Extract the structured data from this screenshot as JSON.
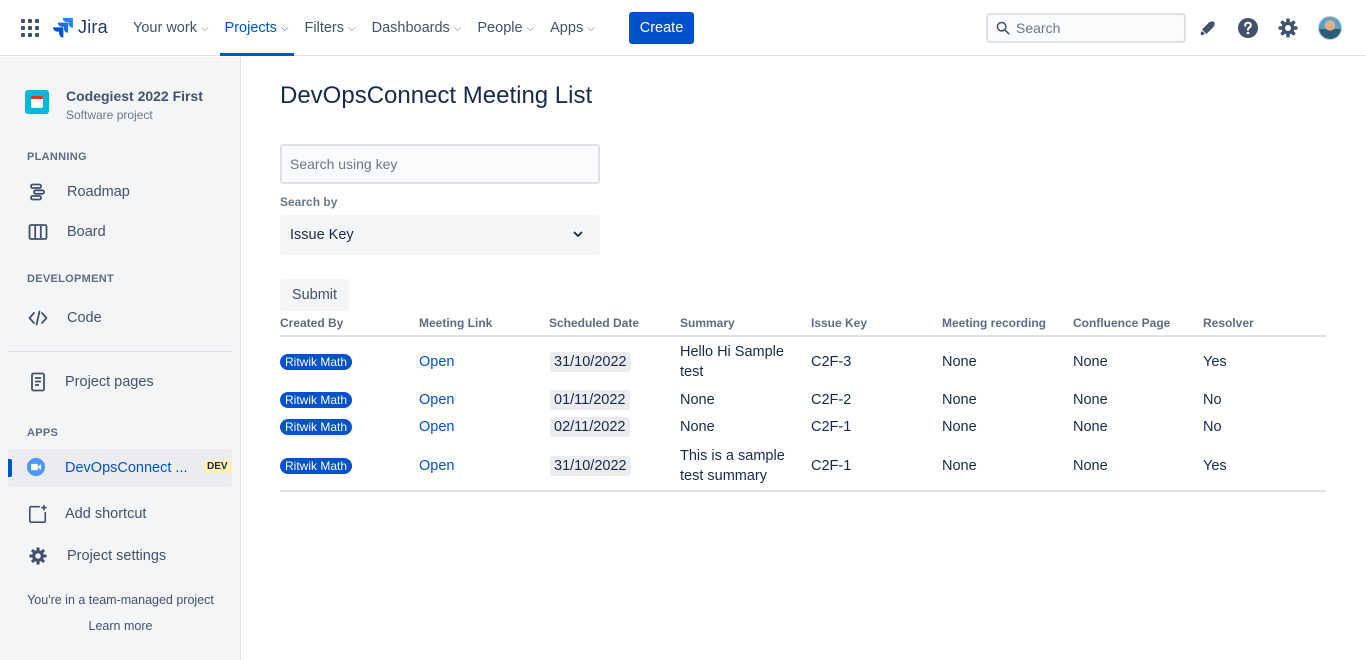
{
  "topnav": {
    "logo_text": "Jira",
    "items": [
      {
        "label": "Your work"
      },
      {
        "label": "Projects"
      },
      {
        "label": "Filters"
      },
      {
        "label": "Dashboards"
      },
      {
        "label": "People"
      },
      {
        "label": "Apps"
      }
    ],
    "active_item": "Projects",
    "create_label": "Create",
    "search_placeholder": "Search"
  },
  "sidebar": {
    "project_name": "Codegiest 2022 First",
    "project_type": "Software project",
    "sections": {
      "planning": "PLANNING",
      "development": "DEVELOPMENT",
      "apps": "APPS"
    },
    "items": {
      "roadmap": "Roadmap",
      "board": "Board",
      "code": "Code",
      "project_pages": "Project pages",
      "devops": "DevOpsConnect ...",
      "devops_badge": "DEV",
      "add_shortcut": "Add shortcut",
      "project_settings": "Project settings"
    },
    "team_note": "You're in a team-managed project",
    "learn_more": "Learn more"
  },
  "main": {
    "title": "DevOpsConnect Meeting List",
    "key_input_placeholder": "Search using key",
    "search_by_label": "Search by",
    "search_by_value": "Issue Key",
    "submit_label": "Submit",
    "table": {
      "headers": [
        "Created By",
        "Meeting Link",
        "Scheduled Date",
        "Summary",
        "Issue Key",
        "Meeting recording",
        "Confluence Page",
        "Resolver"
      ],
      "rows": [
        {
          "created_by": "Ritwik Math",
          "link": "Open",
          "date": "31/10/2022",
          "summary": "Hello Hi Sample test",
          "key": "C2F-3",
          "recording": "None",
          "confluence": "None",
          "resolver": "Yes"
        },
        {
          "created_by": "Ritwik Math",
          "link": "Open",
          "date": "01/11/2022",
          "summary": "None",
          "key": "C2F-2",
          "recording": "None",
          "confluence": "None",
          "resolver": "No"
        },
        {
          "created_by": "Ritwik Math",
          "link": "Open",
          "date": "02/11/2022",
          "summary": "None",
          "key": "C2F-1",
          "recording": "None",
          "confluence": "None",
          "resolver": "No"
        },
        {
          "created_by": "Ritwik Math",
          "link": "Open",
          "date": "31/10/2022",
          "summary": "This is a sample test summary",
          "key": "C2F-1",
          "recording": "None",
          "confluence": "None",
          "resolver": "Yes"
        }
      ]
    }
  },
  "colors": {
    "brand": "#0052cc",
    "text": "#172b4d",
    "sidebar_bg": "#f4f5f7"
  }
}
